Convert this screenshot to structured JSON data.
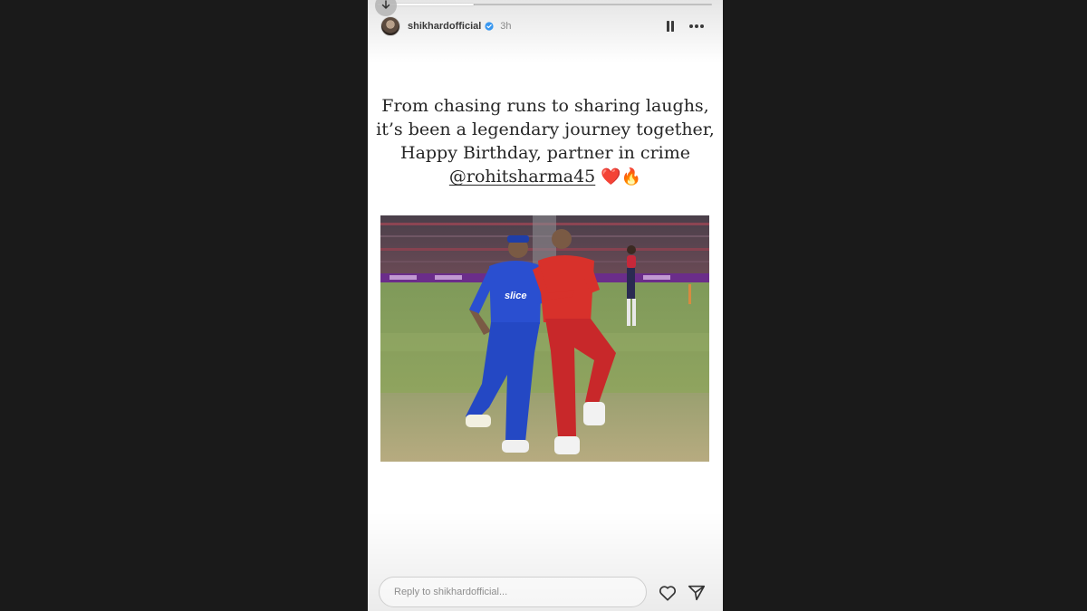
{
  "story": {
    "progress_fraction": 0.29,
    "user": {
      "username": "shikhardofficial",
      "verified": true,
      "time_ago": "3h"
    },
    "header_icons": [
      "download-icon",
      "pause-icon",
      "more-icon",
      "verified-badge-icon"
    ],
    "caption": {
      "line1": "From chasing runs to sharing laughs,",
      "line2": "it’s been a legendary journey together,",
      "line3": "Happy Birthday, partner in crime",
      "mention": "@rohitsharma45",
      "emoji_heart": "❤️",
      "emoji_fire": "🔥"
    },
    "photo": {
      "left_jersey_text": "slice"
    },
    "footer": {
      "reply_placeholder": "Reply to shikhardofficial...",
      "icons": [
        "heart-icon",
        "send-icon"
      ]
    },
    "colors": {
      "page_background": "#1a1a1a",
      "story_background": "#ffffff",
      "text_primary": "#262626",
      "mi_blue": "#2a4fd0",
      "pbks_red": "#d8312b",
      "pitch_green": "#8fa860"
    }
  }
}
